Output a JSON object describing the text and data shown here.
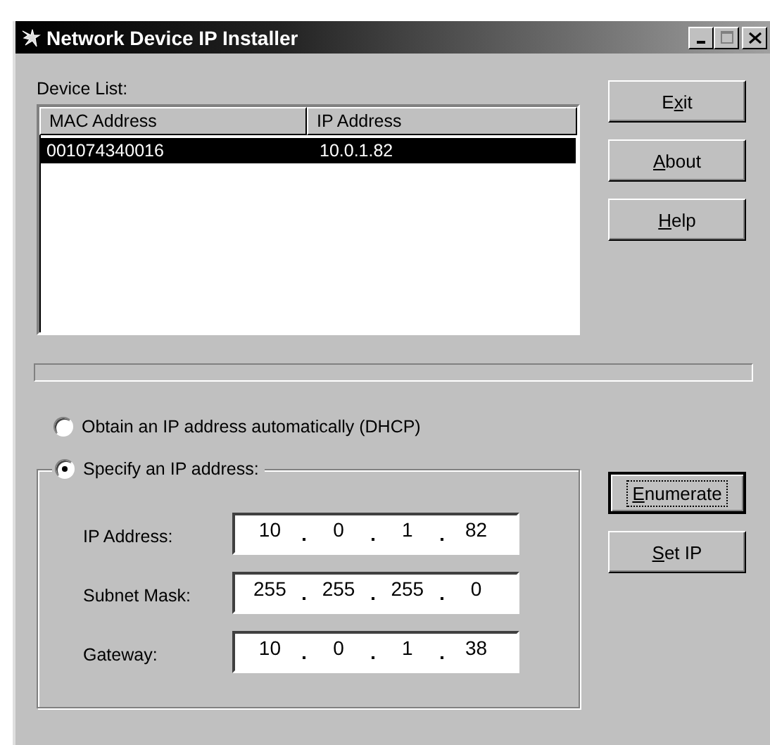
{
  "window": {
    "title": "Network Device IP Installer"
  },
  "device_list": {
    "label": "Device List:",
    "columns": [
      "MAC Address",
      "IP Address"
    ],
    "rows": [
      {
        "cells": [
          "001074340016",
          "10.0.1.82"
        ],
        "selected": true
      }
    ]
  },
  "top_buttons": [
    {
      "pre": "E",
      "key": "x",
      "post": "it",
      "focused": false
    },
    {
      "key": "A",
      "post": "bout",
      "focused": false
    },
    {
      "key": "H",
      "post": "elp",
      "focused": false
    }
  ],
  "mode_options": [
    {
      "label": "Obtain an IP address automatically (DHCP)",
      "selected": false
    },
    {
      "label": "Specify an IP address:",
      "selected": true
    }
  ],
  "fields": [
    {
      "label": "IP Address:",
      "octets": [
        "10",
        "0",
        "1",
        "82"
      ]
    },
    {
      "label": "Subnet Mask:",
      "octets": [
        "255",
        "255",
        "255",
        "0"
      ]
    },
    {
      "label": "Gateway:",
      "octets": [
        "10",
        "0",
        "1",
        "38"
      ]
    }
  ],
  "bottom_buttons": [
    {
      "key": "E",
      "post": "numerate",
      "focused": true
    },
    {
      "key": "S",
      "post": "et IP",
      "focused": false
    }
  ]
}
